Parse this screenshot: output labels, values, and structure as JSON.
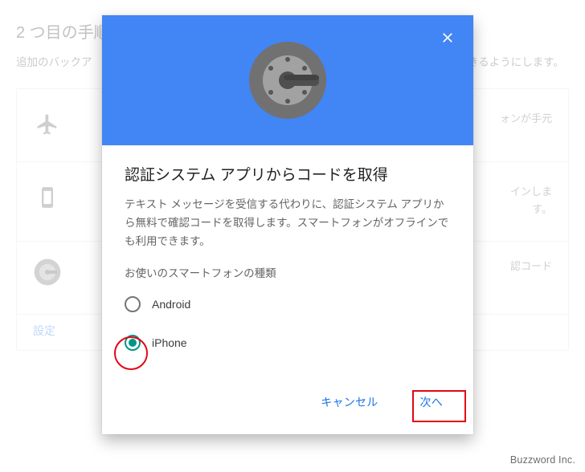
{
  "page": {
    "title": "2 つ目の手順",
    "lead_prefix": "追加のバックア",
    "lead_suffix": "きるようにします。",
    "rows": {
      "r1_suffix": "ォンが手元",
      "r2_line1_suffix": "インしま",
      "r2_line2": "す。",
      "r3_suffix": "認コード"
    },
    "settings": "設定"
  },
  "dialog": {
    "title": "認証システム アプリからコードを取得",
    "desc": "テキスト メッセージを受信する代わりに、認証システム アプリから無料で確認コードを取得します。スマートフォンがオフラインでも利用できます。",
    "question": "お使いのスマートフォンの種類",
    "option_android": "Android",
    "option_iphone": "iPhone",
    "cancel": "キャンセル",
    "next": "次へ"
  },
  "icons": {
    "close": "close-icon",
    "authenticator": "authenticator-icon",
    "airplane": "airplane-icon",
    "smartphone": "smartphone-icon",
    "auth_small": "authenticator-small-icon"
  },
  "watermark": "Buzzword Inc."
}
